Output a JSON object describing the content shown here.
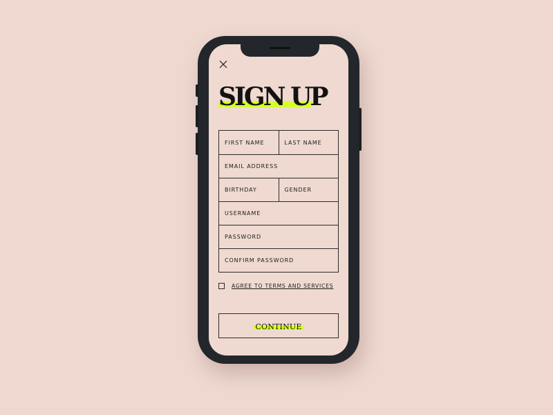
{
  "colors": {
    "background": "#eed8d0",
    "screen": "#efd9d0",
    "phone_frame": "#23272c",
    "highlight": "#d6ff2a",
    "ink": "#121212"
  },
  "header": {
    "close_icon": "close-icon",
    "title": "SIGN UP"
  },
  "form": {
    "first_name": "FIRST NAME",
    "last_name": "LAST NAME",
    "email": "EMAIL ADDRESS",
    "birthday": "BIRTHDAY",
    "gender": "GENDER",
    "username": "USERNAME",
    "password": "PASSWORD",
    "confirm_password": "CONFIRM PASSWORD"
  },
  "terms": {
    "checked": false,
    "label": "AGREE TO TERMS AND SERVICES"
  },
  "actions": {
    "continue_label": "CONTINUE"
  }
}
